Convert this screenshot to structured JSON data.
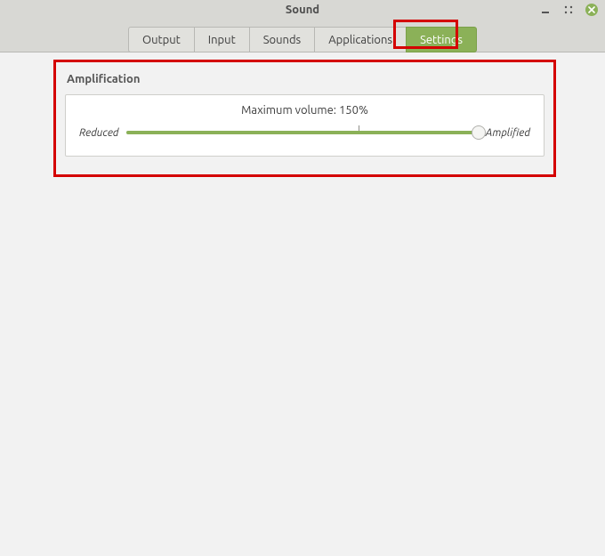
{
  "window": {
    "title": "Sound"
  },
  "tabs": {
    "output": {
      "label": "Output"
    },
    "input": {
      "label": "Input"
    },
    "sounds": {
      "label": "Sounds"
    },
    "applications": {
      "label": "Applications"
    },
    "settings": {
      "label": "Settings"
    }
  },
  "settings": {
    "section_title": "Amplification",
    "max_volume_label": "Maximum volume: 150%",
    "slider": {
      "reduced_label": "Reduced",
      "amplified_label": "Amplified"
    }
  }
}
